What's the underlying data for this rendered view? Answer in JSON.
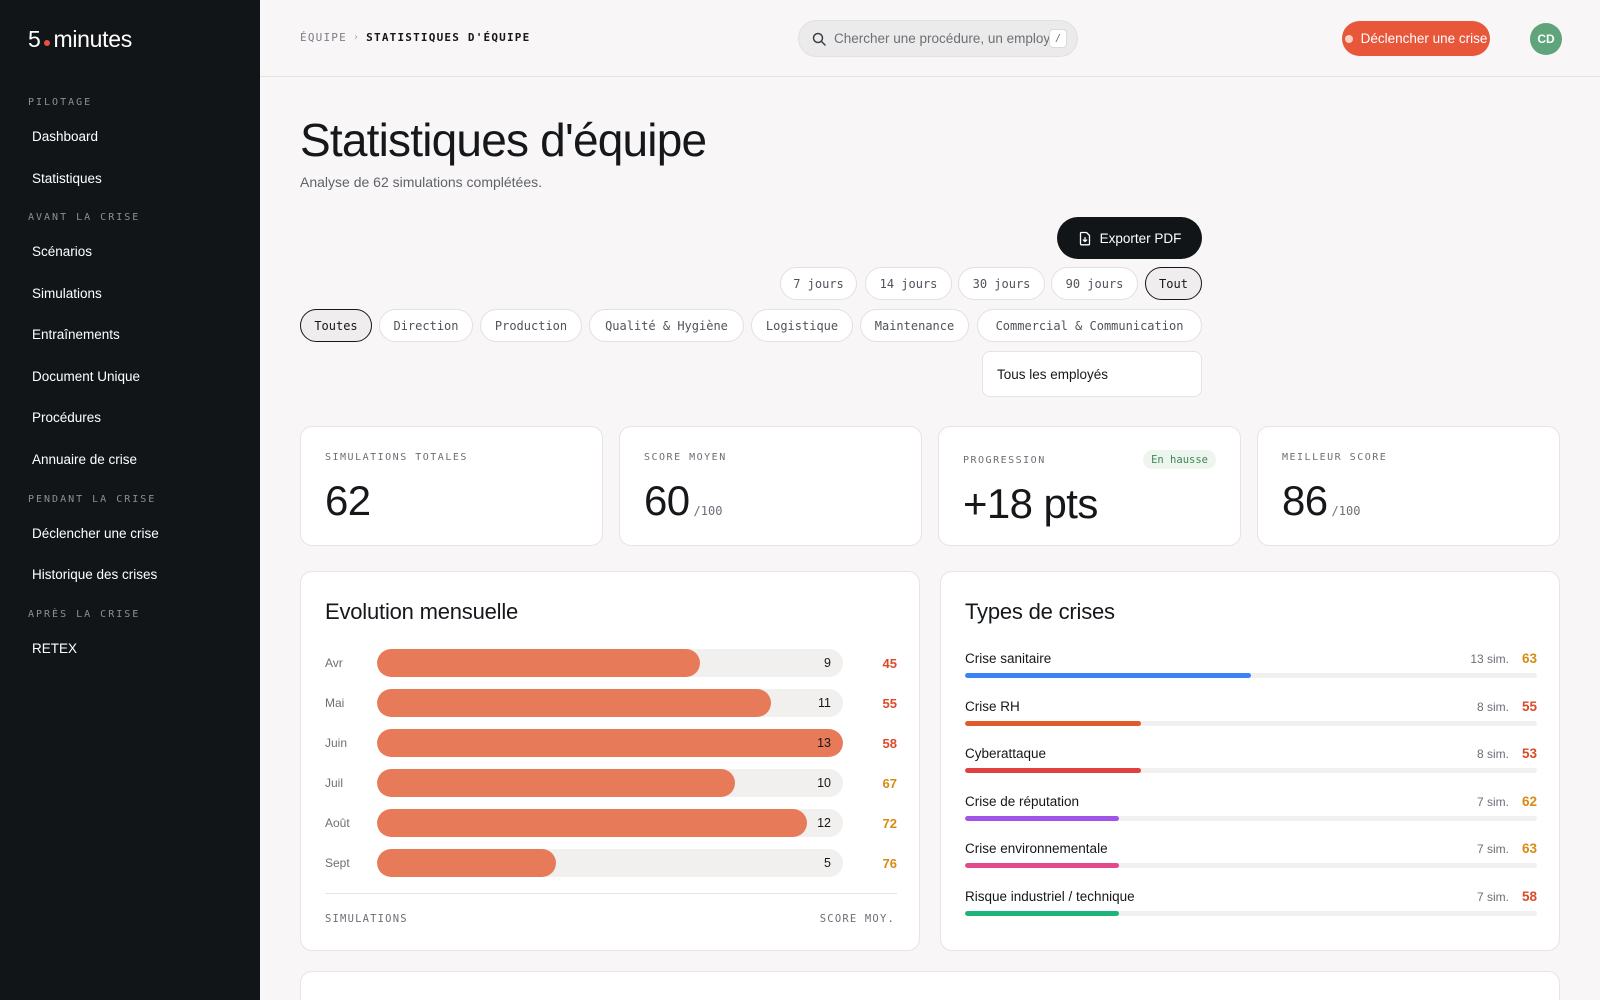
{
  "app": {
    "logo_prefix": "5",
    "logo_suffix": "minutes",
    "accent": "#e8573a"
  },
  "sidebar": {
    "sections": [
      {
        "label": "PILOTAGE",
        "items": [
          "Dashboard",
          "Statistiques"
        ]
      },
      {
        "label": "AVANT LA CRISE",
        "items": [
          "Scénarios",
          "Simulations",
          "Entraînements",
          "Document Unique",
          "Procédures",
          "Annuaire de crise"
        ]
      },
      {
        "label": "PENDANT LA CRISE",
        "items": [
          "Déclencher une crise",
          "Historique des crises"
        ]
      },
      {
        "label": "APRÈS LA CRISE",
        "items": [
          "RETEX"
        ]
      }
    ]
  },
  "topbar": {
    "breadcrumb": {
      "parent": "ÉQUIPE",
      "separator": "›",
      "current": "STATISTIQUES D'ÉQUIPE"
    },
    "search": {
      "placeholder": "Chercher une procédure, un employé…",
      "shortcut": "/"
    },
    "crisis_button": "Déclencher une crise",
    "avatar_initials": "CD"
  },
  "header": {
    "title": "Statistiques d'équipe",
    "subtitle": "Analyse de 62 simulations complétées."
  },
  "actions": {
    "export_label": "Exporter PDF"
  },
  "period_filters": {
    "options": [
      "7 jours",
      "14 jours",
      "30 jours",
      "90 jours",
      "Tout"
    ],
    "selected": "Tout"
  },
  "department_filters": {
    "options": [
      "Toutes",
      "Direction",
      "Production",
      "Qualité & Hygiène",
      "Logistique",
      "Maintenance",
      "Commercial & Communication"
    ],
    "selected": "Toutes"
  },
  "employee_select": {
    "value": "Tous les employés"
  },
  "stats": {
    "total": {
      "label": "SIMULATIONS TOTALES",
      "value": "62"
    },
    "average": {
      "label": "SCORE MOYEN",
      "value": "60",
      "unit": "/100"
    },
    "progress": {
      "label": "PROGRESSION",
      "value": "+18 pts",
      "badge": "En hausse"
    },
    "best": {
      "label": "MEILLEUR SCORE",
      "value": "86",
      "unit": "/100"
    }
  },
  "monthly": {
    "title": "Evolution mensuelle",
    "footer_left": "SIMULATIONS",
    "footer_right": "SCORE MOY.",
    "max_simulations": 13,
    "rows": [
      {
        "month": "Avr",
        "simulations": "9",
        "score": "45",
        "color": "#dc4a28"
      },
      {
        "month": "Mai",
        "simulations": "11",
        "score": "55",
        "color": "#dc4a28"
      },
      {
        "month": "Juin",
        "simulations": "13",
        "score": "58",
        "color": "#dc4a28"
      },
      {
        "month": "Juil",
        "simulations": "10",
        "score": "67",
        "color": "#d98a12"
      },
      {
        "month": "Août",
        "simulations": "12",
        "score": "72",
        "color": "#d98a12"
      },
      {
        "month": "Sept",
        "simulations": "5",
        "score": "76",
        "color": "#d98a12"
      }
    ]
  },
  "crisis_types": {
    "title": "Types de crises",
    "sims_suffix": " sim.",
    "bar_max": 26,
    "rows": [
      {
        "name": "Crise sanitaire",
        "sims": "13",
        "score": "63",
        "bar_color": "#3b82f6",
        "score_color": "#d98a12"
      },
      {
        "name": "Crise RH",
        "sims": "8",
        "score": "55",
        "bar_color": "#e05a2b",
        "score_color": "#dc4a28"
      },
      {
        "name": "Cyberattaque",
        "sims": "8",
        "score": "53",
        "bar_color": "#e0403f",
        "score_color": "#dc4a28"
      },
      {
        "name": "Crise de réputation",
        "sims": "7",
        "score": "62",
        "bar_color": "#a155e6",
        "score_color": "#d98a12"
      },
      {
        "name": "Crise environnementale",
        "sims": "7",
        "score": "63",
        "bar_color": "#e34a8c",
        "score_color": "#d98a12"
      },
      {
        "name": "Risque industriel / technique",
        "sims": "7",
        "score": "58",
        "bar_color": "#1fb37c",
        "score_color": "#dc4a28"
      }
    ]
  }
}
